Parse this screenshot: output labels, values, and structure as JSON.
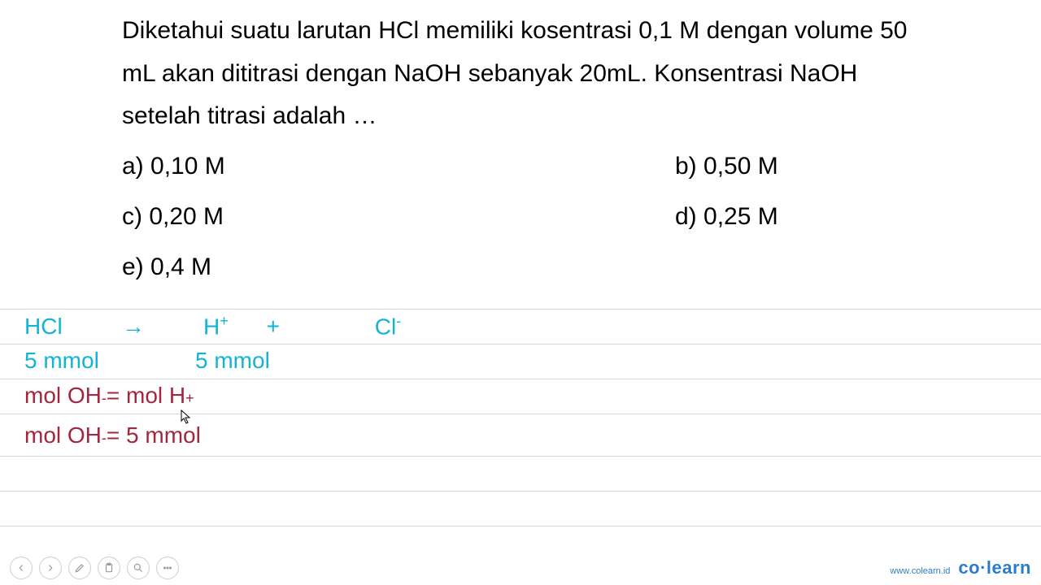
{
  "question": {
    "text": "Diketahui suatu larutan HCl memiliki kosentrasi 0,1 M dengan volume 50 mL akan dititrasi dengan NaOH sebanyak 20mL. Konsentrasi NaOH setelah titrasi adalah …"
  },
  "options": {
    "a": "a)  0,10 M",
    "b": "b)  0,50 M",
    "c": "c)  0,20 M",
    "d": "d)  0,25 M",
    "e": "e)  0,4 M"
  },
  "work": {
    "line1": {
      "hcl": "HCl",
      "arrow": "→",
      "h": "H",
      "h_sup": "+",
      "plus": "+",
      "cl": "Cl",
      "cl_sup": "-"
    },
    "line2": {
      "left": "5 mmol",
      "right": "5 mmol"
    },
    "line3": {
      "prefix": "mol OH",
      "sup1": "-",
      "mid": " = mol H",
      "sup2": "+"
    },
    "line4": {
      "prefix": "mol OH",
      "sup1": "-",
      "rest": " = 5 mmol"
    }
  },
  "footer": {
    "url": "www.colearn.id",
    "brand": "co·learn"
  },
  "icons": {
    "prev": "prev-icon",
    "next": "next-icon",
    "pen": "pen-icon",
    "clipboard": "clipboard-icon",
    "zoom": "zoom-icon",
    "more": "more-icon"
  }
}
